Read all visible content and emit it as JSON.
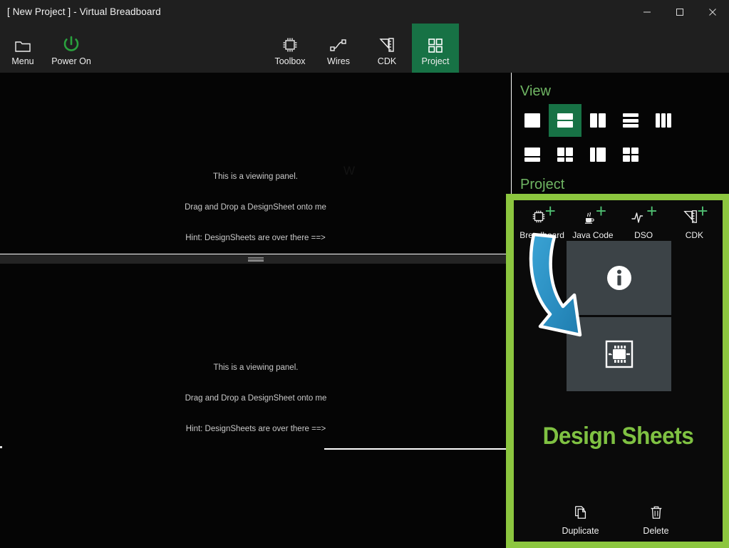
{
  "window": {
    "title": "[ New Project ] - Virtual Breadboard",
    "controls": [
      {
        "name": "minimize",
        "glyph": "minimize-icon"
      },
      {
        "name": "maximize",
        "glyph": "maximize-icon"
      },
      {
        "name": "close",
        "glyph": "close-icon"
      }
    ]
  },
  "colors": {
    "accent_green": "#8cc63f",
    "button_green": "#177245",
    "header_green": "#6fb563",
    "title_green": "#7fc142",
    "plus_green": "#4fbf72",
    "tile_bg": "#3c4347",
    "arrow_blue": "#2a93c9",
    "background": "#050505",
    "chrome": "#1f1f1f"
  },
  "toolbar": {
    "left_items": [
      {
        "label": "Menu",
        "icon": "folder-icon"
      },
      {
        "label": "Power On",
        "icon": "power-icon"
      }
    ],
    "center_items": [
      {
        "label": "Toolbox",
        "icon": "chip-outline-icon",
        "active": false
      },
      {
        "label": "Wires",
        "icon": "wires-icon",
        "active": false
      },
      {
        "label": "CDK",
        "icon": "ruler-pencil-icon",
        "active": false
      },
      {
        "label": "Project",
        "icon": "grid-squares-icon",
        "active": true
      }
    ]
  },
  "workspace": {
    "watermark": "W",
    "panel_top": {
      "line1": "This is a viewing panel.",
      "line2": "Drag and Drop a DesignSheet onto me",
      "line3": "Hint: DesignSheets are over there ==>"
    },
    "panel_bottom": {
      "line1": "This is a viewing panel.",
      "line2": "Drag and Drop a DesignSheet onto me",
      "line3": "Hint: DesignSheets are over there ==>"
    },
    "splitter": "horizontal-splitter"
  },
  "dock": {
    "view": {
      "heading": "View",
      "layouts": [
        {
          "name": "single",
          "active": false,
          "cols": [
            [
              1
            ]
          ]
        },
        {
          "name": "two-rows",
          "active": true,
          "cols": [
            [
              1,
              1
            ]
          ]
        },
        {
          "name": "two-columns",
          "active": false,
          "cols": [
            [
              1
            ],
            [
              1
            ]
          ]
        },
        {
          "name": "three-rows",
          "active": false,
          "cols": [
            [
              1,
              1,
              1
            ]
          ]
        },
        {
          "name": "three-columns",
          "active": false,
          "cols": [
            [
              1
            ],
            [
              1
            ],
            [
              1
            ]
          ]
        },
        {
          "name": "top-large-bottom-row",
          "active": false,
          "cols": [
            [
              2,
              1
            ]
          ]
        },
        {
          "name": "top-split-bottom",
          "active": false,
          "cols": [
            [
              1,
              1
            ],
            [
              1,
              1
            ]
          ]
        },
        {
          "name": "left-narrow-right-wide",
          "active": false,
          "cols": [
            [
              1
            ],
            [
              1
            ]
          ]
        },
        {
          "name": "quad-grid",
          "active": false,
          "cols": [
            [
              1,
              1
            ],
            [
              1,
              1
            ]
          ]
        }
      ]
    },
    "project": {
      "heading": "Project",
      "add_items": [
        {
          "label": "Breadboard",
          "icon": "chip-outline-icon"
        },
        {
          "label": "Java Code",
          "icon": "java-cup-icon"
        },
        {
          "label": "DSO",
          "icon": "waveform-icon"
        },
        {
          "label": "CDK",
          "icon": "ruler-pencil-icon"
        }
      ],
      "tiles": [
        {
          "name": "info-sheet-tile",
          "icon": "info-circle-icon"
        },
        {
          "name": "chip-sheet-tile",
          "icon": "ic-chip-icon"
        }
      ],
      "title": "Design Sheets",
      "actions": [
        {
          "label": "Duplicate",
          "icon": "copy-icon"
        },
        {
          "label": "Delete",
          "icon": "trash-icon"
        }
      ]
    }
  },
  "annotation": {
    "arrow": "curved-blue-arrow"
  }
}
